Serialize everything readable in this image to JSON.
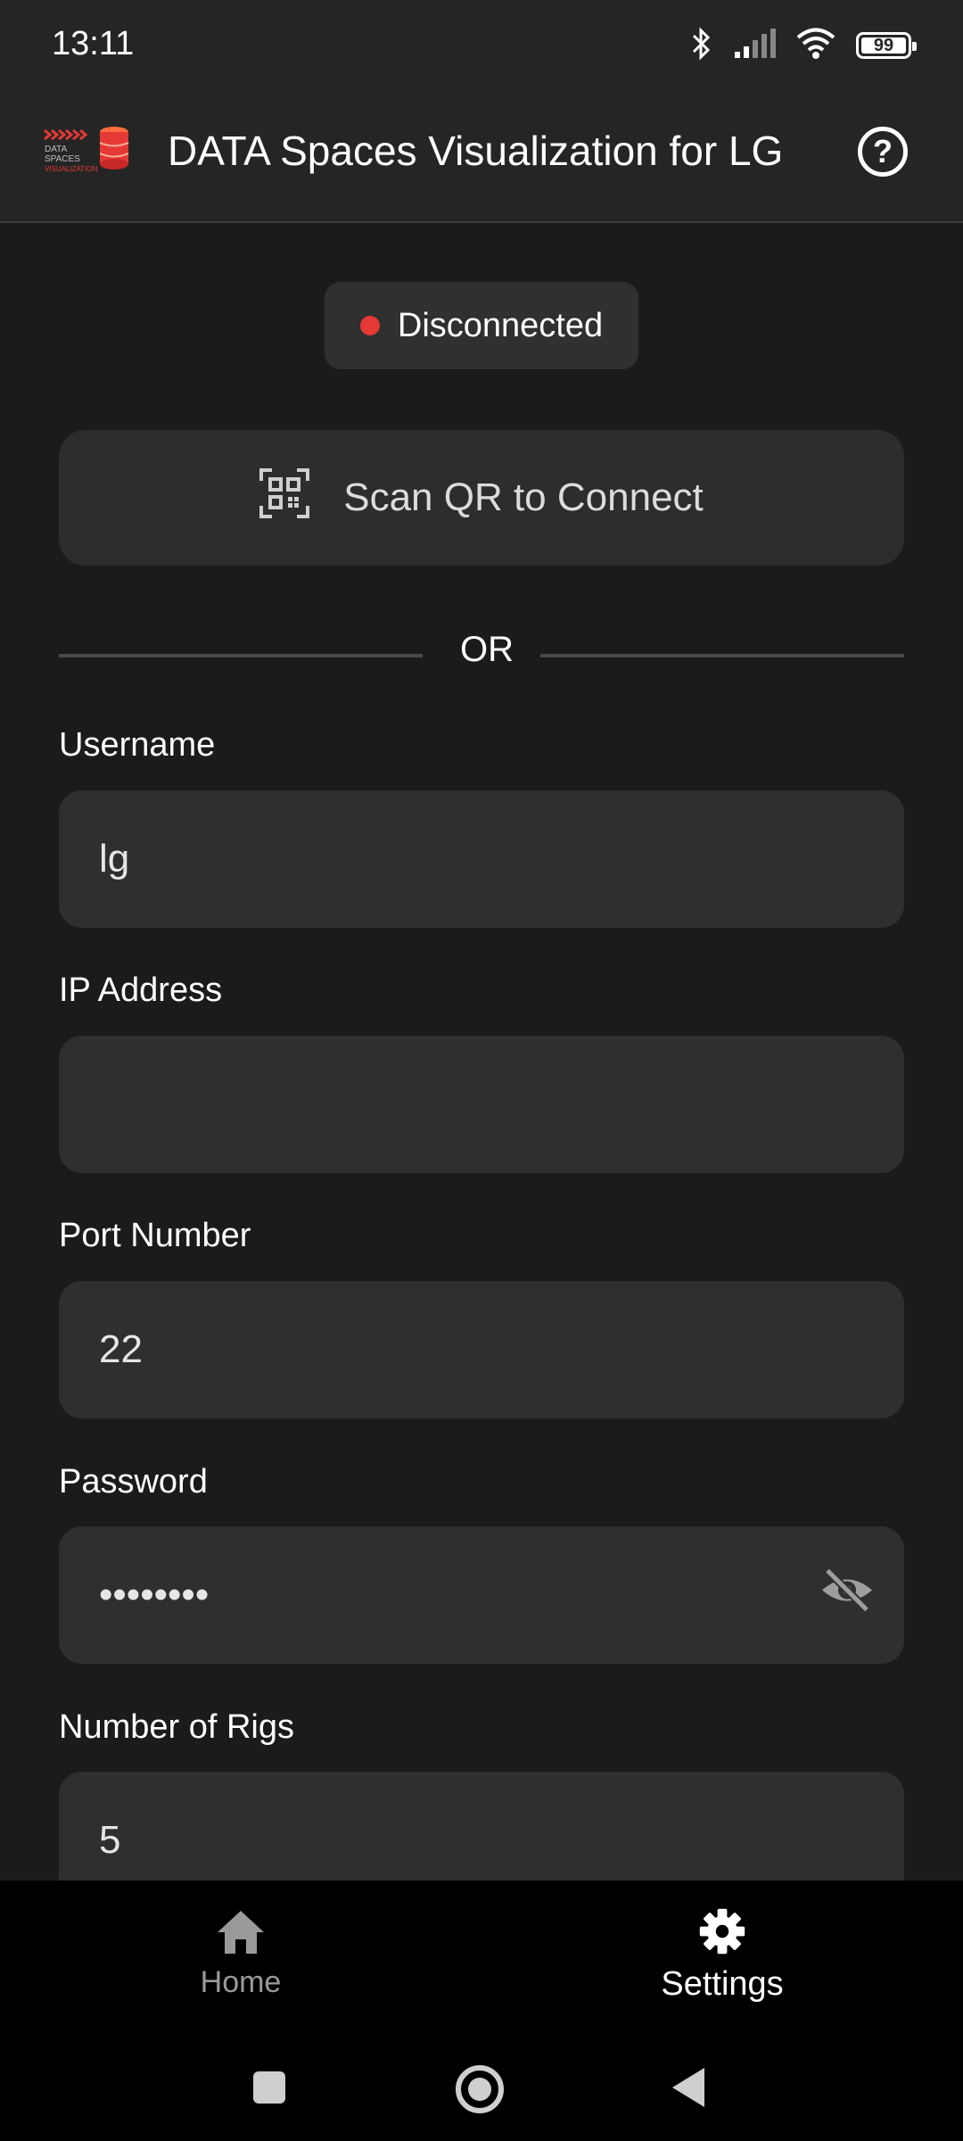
{
  "status_bar": {
    "time": "13:11",
    "battery": "99"
  },
  "app_bar": {
    "title": "DATA Spaces Visualization for LG",
    "logo_text": "DATA SPACES VISUALIZATION"
  },
  "connection": {
    "status": "Disconnected",
    "status_color": "#e53935"
  },
  "scan": {
    "label": "Scan QR to Connect"
  },
  "divider": {
    "text": "OR"
  },
  "form": {
    "username": {
      "label": "Username",
      "value": "lg"
    },
    "ip": {
      "label": "IP Address",
      "value": ""
    },
    "port": {
      "label": "Port Number",
      "value": "22"
    },
    "password": {
      "label": "Password",
      "value": "••••••••"
    },
    "rigs": {
      "label": "Number of Rigs",
      "value": "5"
    }
  },
  "bottom_nav": {
    "items": [
      {
        "label": "Home",
        "icon": "home-icon",
        "selected": false
      },
      {
        "label": "Settings",
        "icon": "gear-icon",
        "selected": true
      }
    ]
  }
}
